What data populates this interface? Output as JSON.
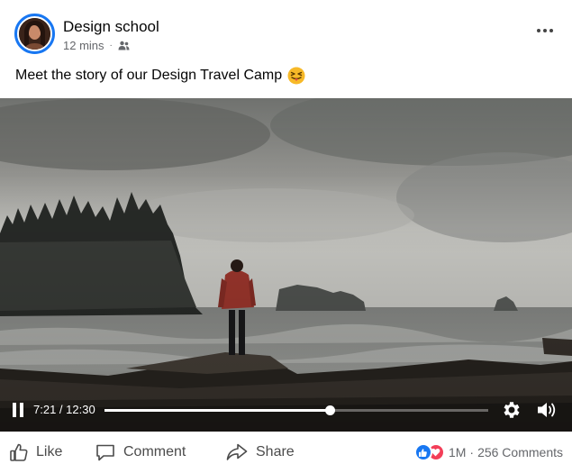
{
  "post": {
    "author": "Design school",
    "time": "12 mins",
    "separator": "·",
    "audience_icon": "friends-icon",
    "caption": "Meet the story of our Design Travel Camp",
    "caption_emoji": "squinting-tongue-emoji"
  },
  "video": {
    "state": "playing",
    "time_display": "7:21 / 12:30",
    "current": "7:21",
    "duration": "12:30",
    "progress_fraction": 0.588,
    "icons": [
      "pause-icon",
      "settings-icon",
      "volume-icon"
    ]
  },
  "actions": {
    "like_label": "Like",
    "comment_label": "Comment",
    "share_label": "Share"
  },
  "reactions": {
    "count": "1M",
    "separator": "·",
    "comments": "256 Comments"
  },
  "colors": {
    "accent": "#1877f2",
    "love": "#f33e58",
    "text": "#050505",
    "muted": "#65676b"
  }
}
